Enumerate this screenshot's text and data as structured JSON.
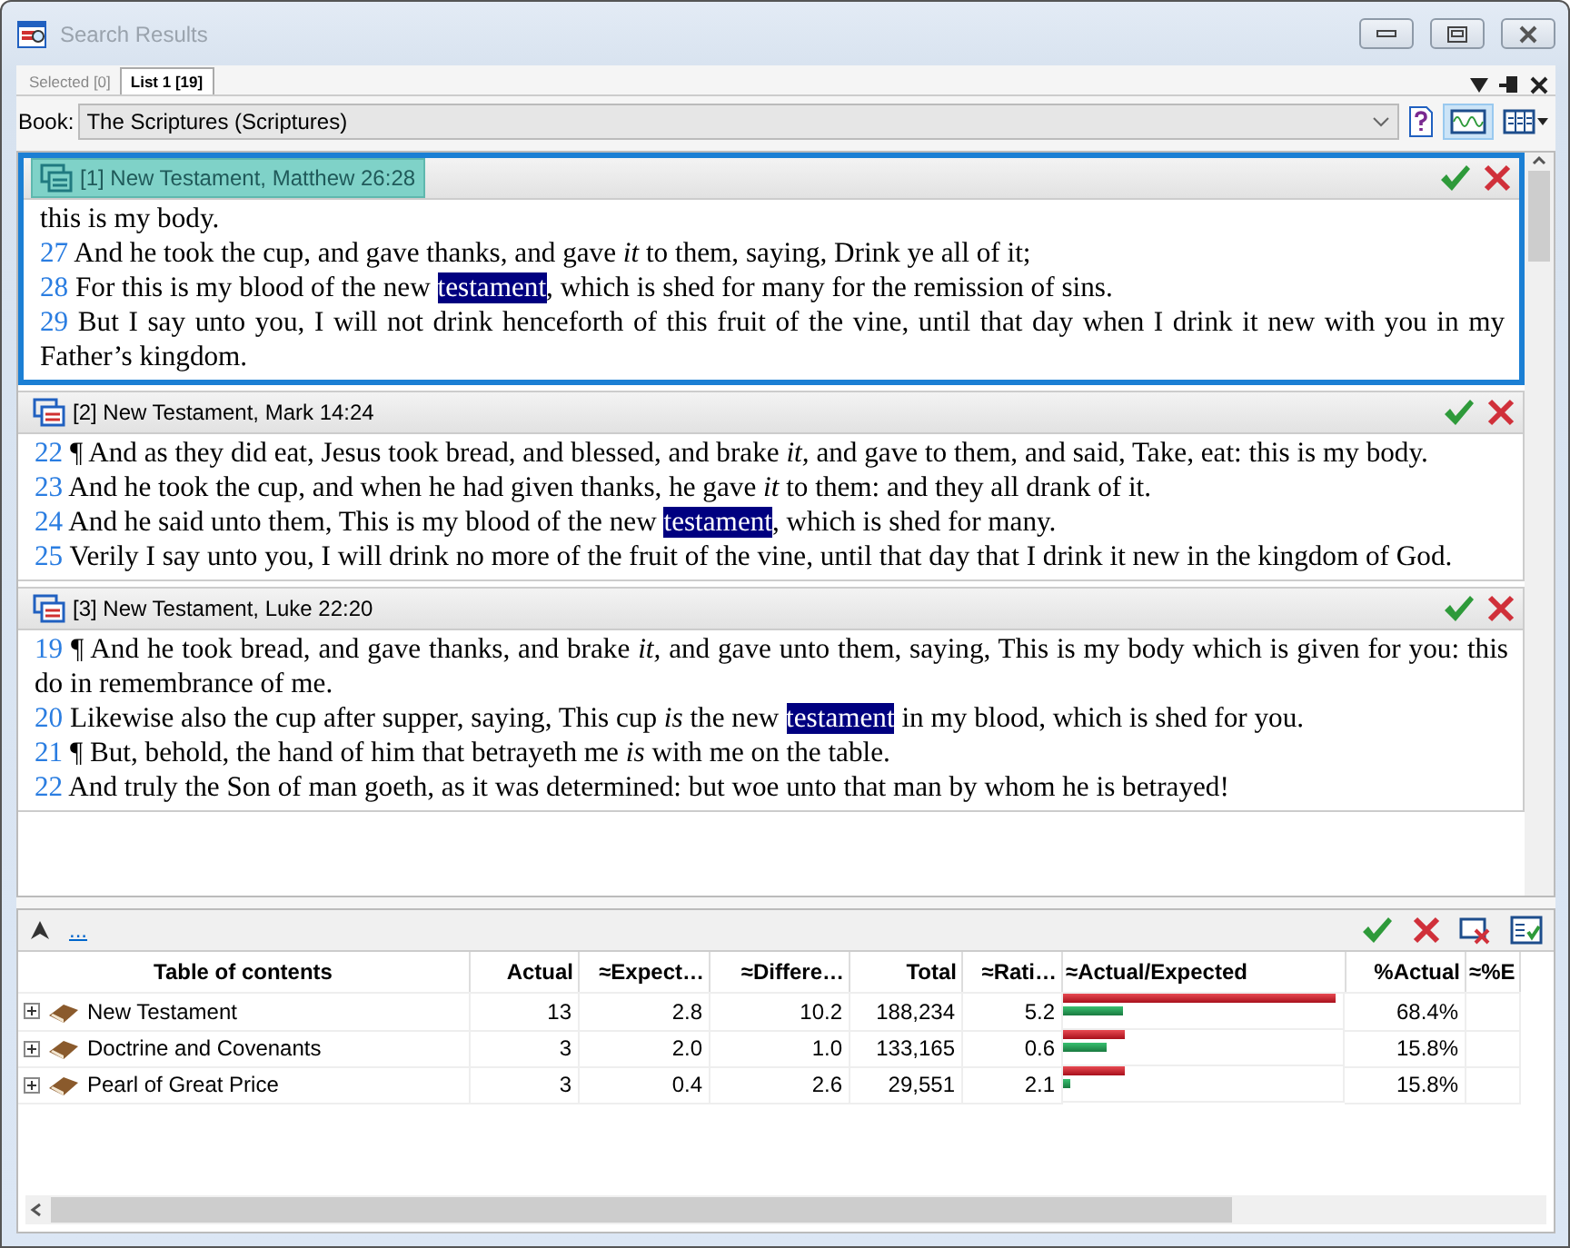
{
  "window": {
    "title": "Search Results"
  },
  "tabs": [
    {
      "label": "Selected [0]",
      "selected": false
    },
    {
      "label": "List 1 [19]",
      "selected": true
    }
  ],
  "book": {
    "label": "Book:",
    "value": "The Scriptures (Scriptures)"
  },
  "results": [
    {
      "title": "[1] New Testament, Matthew 26:28",
      "selected": true,
      "verses": [
        {
          "text": "this is my body."
        },
        {
          "num": "27",
          "text": "And he took the cup, and gave thanks, and gave *it* to them, saying, Drink ye all of it;"
        },
        {
          "num": "28",
          "text": "For this is my blood of the new",
          "hit": "testament",
          "after": ", which is shed for many for the remission of sins."
        },
        {
          "num": "29",
          "text": "But I say unto you, I will not drink henceforth of this fruit of the vine, until that day when I drink it new with you in my Father’s kingdom."
        }
      ]
    },
    {
      "title": "[2] New Testament, Mark 14:24",
      "selected": false,
      "verses": [
        {
          "num": "22",
          "text": "¶ And as they did eat, Jesus took bread, and blessed, and brake *it,* and gave to them, and said, Take, eat: this is my body."
        },
        {
          "num": "23",
          "text": "And he took the cup, and when he had given thanks, he gave *it* to them: and they all drank of it."
        },
        {
          "num": "24",
          "text": "And he said unto them, This is my blood of the new",
          "hit": "testament",
          "after": ", which is shed for many."
        },
        {
          "num": "25",
          "text": "Verily I say unto you, I will drink no more of the fruit of the vine, until that day that I drink it new in the kingdom of God."
        }
      ]
    },
    {
      "title": "[3] New Testament, Luke 22:20",
      "selected": false,
      "verses": [
        {
          "num": "19",
          "text": "¶ And he took bread, and gave thanks, and brake *it,* and gave unto them, saying, This is my body which is given for you: this do in remembrance of me."
        },
        {
          "num": "20",
          "text": "Likewise also the cup after supper, saying, This cup *is* the new",
          "hit": "testament",
          "after": " in my blood, which is shed for you."
        },
        {
          "num": "21",
          "text": "¶ But, behold, the hand of him that betrayeth me *is* with me on the table."
        },
        {
          "num": "22",
          "text": "And truly the Son of man goeth, as it was determined: but woe unto that man by whom he is betrayed!"
        }
      ]
    }
  ],
  "stats": {
    "link": "...",
    "columns": [
      "Table of contents",
      "Actual",
      "≈Expect…",
      "≈Differe…",
      "Total",
      "≈Rati…",
      "≈Actual/Expected",
      "%Actual",
      "≈%E"
    ],
    "rows": [
      {
        "name": "New Testament",
        "actual": "13",
        "expected": "2.8",
        "difference": "10.2",
        "total": "188,234",
        "ratio": "5.2",
        "actual_bar": {
          "level": 1.0
        },
        "expected_bar": {
          "level": 0.22
        },
        "percent_actual": "68.4%"
      },
      {
        "name": "Doctrine and Covenants",
        "actual": "3",
        "expected": "2.0",
        "difference": "1.0",
        "total": "133,165",
        "ratio": "0.6",
        "actual_bar": {
          "level": 0.23
        },
        "expected_bar": {
          "level": 0.16
        },
        "percent_actual": "15.8%"
      },
      {
        "name": "Pearl of Great Price",
        "actual": "3",
        "expected": "0.4",
        "difference": "2.6",
        "total": "29,551",
        "ratio": "2.1",
        "actual_bar": {
          "level": 0.23
        },
        "expected_bar": {
          "level": 0.03
        },
        "percent_actual": "15.8%"
      }
    ]
  }
}
